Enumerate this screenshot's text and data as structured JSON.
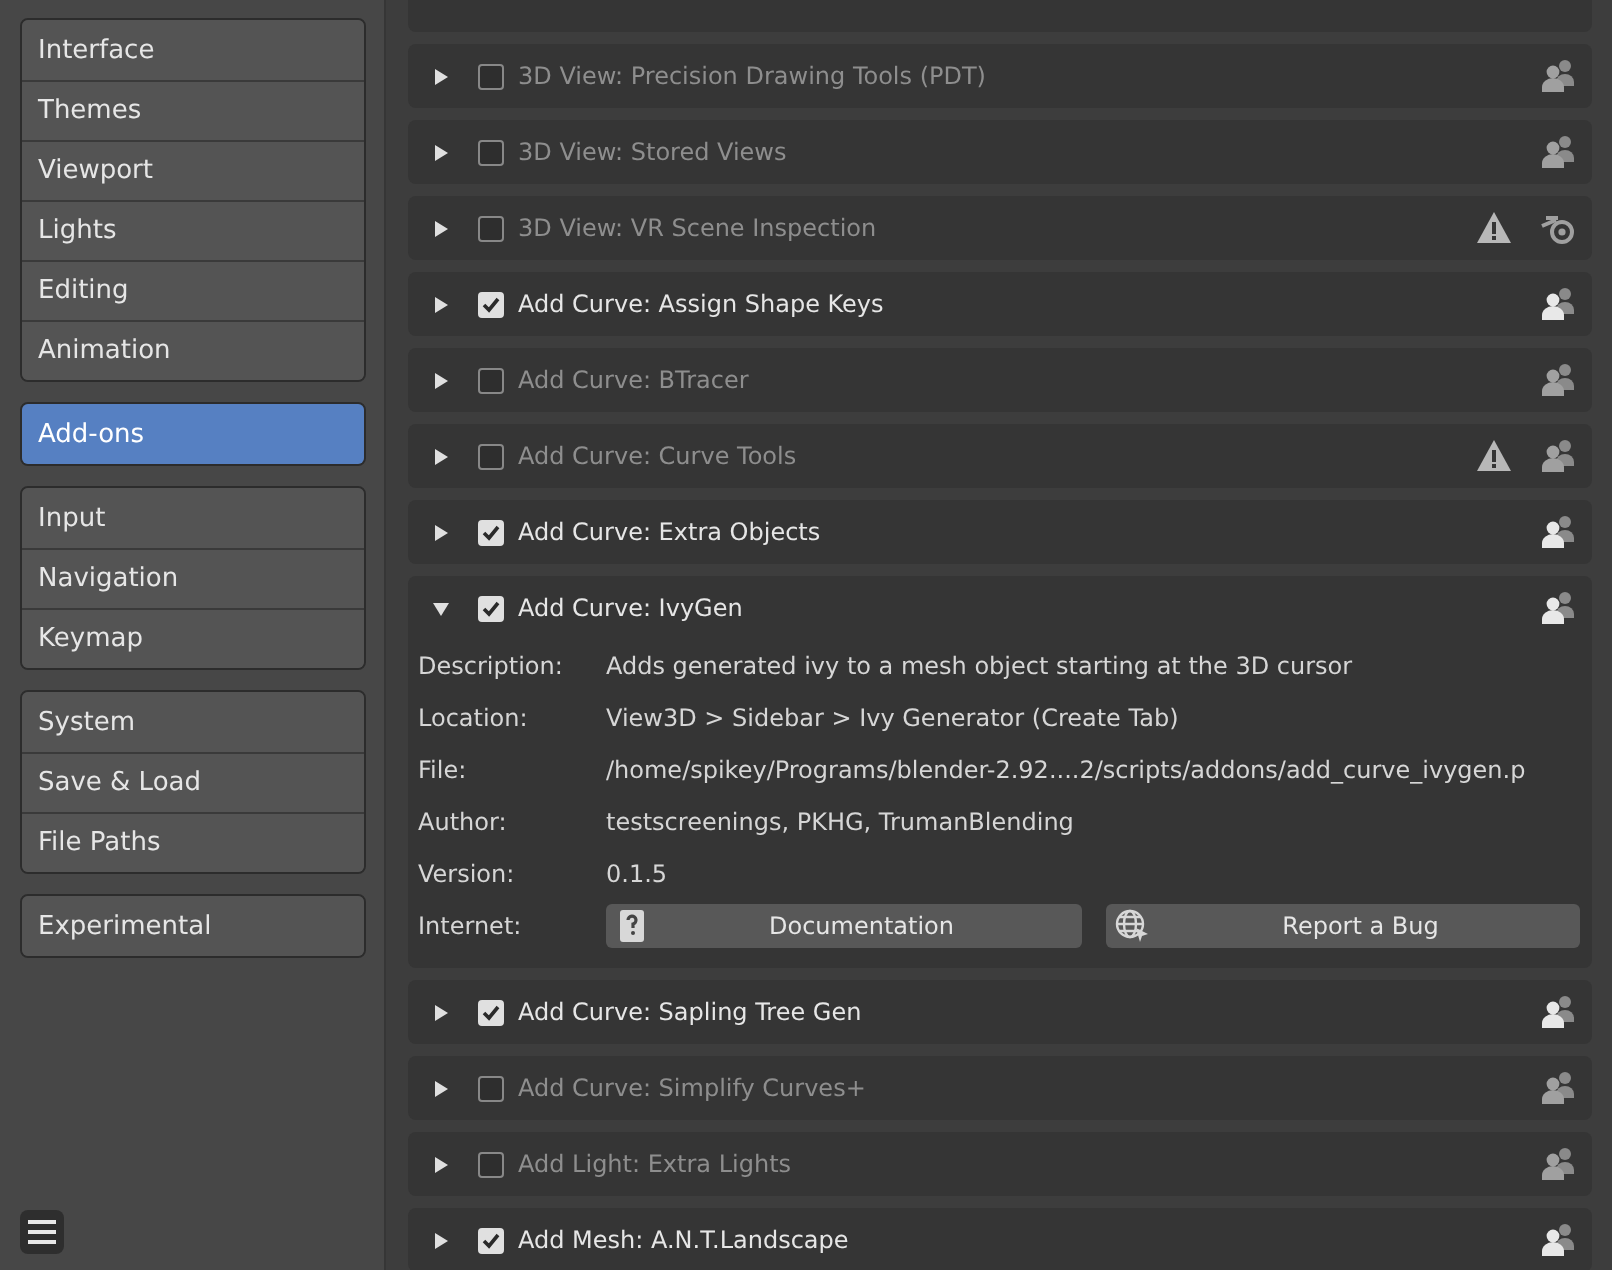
{
  "sidebar": {
    "groups": [
      [
        {
          "label": "Interface",
          "selected": false
        },
        {
          "label": "Themes",
          "selected": false
        },
        {
          "label": "Viewport",
          "selected": false
        },
        {
          "label": "Lights",
          "selected": false
        },
        {
          "label": "Editing",
          "selected": false
        },
        {
          "label": "Animation",
          "selected": false
        }
      ],
      [
        {
          "label": "Add-ons",
          "selected": true
        }
      ],
      [
        {
          "label": "Input",
          "selected": false
        },
        {
          "label": "Navigation",
          "selected": false
        },
        {
          "label": "Keymap",
          "selected": false
        }
      ],
      [
        {
          "label": "System",
          "selected": false
        },
        {
          "label": "Save & Load",
          "selected": false
        },
        {
          "label": "File Paths",
          "selected": false
        }
      ],
      [
        {
          "label": "Experimental",
          "selected": false
        }
      ]
    ]
  },
  "addons": [
    {
      "name": "3D View: Precision Drawing Tools (PDT)",
      "enabled": false,
      "expanded": false,
      "warning": false,
      "kind": "community"
    },
    {
      "name": "3D View: Stored Views",
      "enabled": false,
      "expanded": false,
      "warning": false,
      "kind": "community"
    },
    {
      "name": "3D View: VR Scene Inspection",
      "enabled": false,
      "expanded": false,
      "warning": true,
      "kind": "official"
    },
    {
      "name": "Add Curve: Assign Shape Keys",
      "enabled": true,
      "expanded": false,
      "warning": false,
      "kind": "community"
    },
    {
      "name": "Add Curve: BTracer",
      "enabled": false,
      "expanded": false,
      "warning": false,
      "kind": "community"
    },
    {
      "name": "Add Curve: Curve Tools",
      "enabled": false,
      "expanded": false,
      "warning": true,
      "kind": "community"
    },
    {
      "name": "Add Curve: Extra Objects",
      "enabled": true,
      "expanded": false,
      "warning": false,
      "kind": "community"
    },
    {
      "name": "Add Curve: IvyGen",
      "enabled": true,
      "expanded": true,
      "warning": false,
      "kind": "community",
      "details": [
        {
          "label": "Description:",
          "value": "Adds generated ivy to a mesh object starting at the 3D cursor"
        },
        {
          "label": "Location:",
          "value": "View3D > Sidebar > Ivy Generator (Create Tab)"
        },
        {
          "label": "File:",
          "value": "/home/spikey/Programs/blender-2.92....2/scripts/addons/add_curve_ivygen.p"
        },
        {
          "label": "Author:",
          "value": "testscreenings, PKHG, TrumanBlending"
        },
        {
          "label": "Version:",
          "value": "0.1.5"
        }
      ],
      "internet": {
        "label": "Internet:",
        "links": [
          {
            "label": "Documentation",
            "kind": "docs"
          },
          {
            "label": "Report a Bug",
            "kind": "bug"
          }
        ]
      }
    },
    {
      "name": "Add Curve: Sapling Tree Gen",
      "enabled": true,
      "expanded": false,
      "warning": false,
      "kind": "community"
    },
    {
      "name": "Add Curve: Simplify Curves+",
      "enabled": false,
      "expanded": false,
      "warning": false,
      "kind": "community"
    },
    {
      "name": "Add Light: Extra Lights",
      "enabled": false,
      "expanded": false,
      "warning": false,
      "kind": "community"
    },
    {
      "name": "Add Mesh: A.N.T.Landscape",
      "enabled": true,
      "expanded": false,
      "warning": false,
      "kind": "community"
    }
  ]
}
